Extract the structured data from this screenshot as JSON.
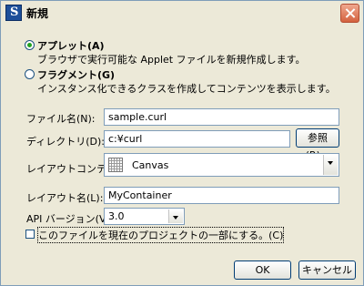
{
  "window": {
    "title": "新規"
  },
  "options": [
    {
      "label": "アプレット(A)",
      "description": "ブラウザで実行可能な Applet ファイルを新規作成します。",
      "selected": true
    },
    {
      "label": "フラグメント(G)",
      "description": "インスタンス化できるクラスを作成してコンテンツを表示します。",
      "selected": false
    }
  ],
  "form": {
    "filename": {
      "label": "ファイル名(N):",
      "value": "sample.curl"
    },
    "directory": {
      "label": "ディレクトリ(D):",
      "value": "c:¥curl",
      "browse_label": "参照(R)..."
    },
    "layout_container": {
      "label": "レイアウトコンテナ(T):",
      "value": "Canvas"
    },
    "layout_name": {
      "label": "レイアウト名(L):",
      "value": "MyContainer"
    },
    "api_version": {
      "label": "API バージョン(V):",
      "value": "3.0"
    },
    "add_to_project": {
      "label": "このファイルを現在のプロジェクトの一部にする。(C)",
      "checked": false
    }
  },
  "buttons": {
    "ok": "OK",
    "cancel": "キャンセル"
  }
}
